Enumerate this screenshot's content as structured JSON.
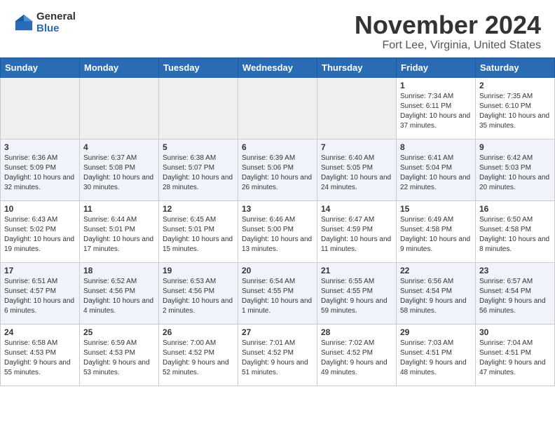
{
  "header": {
    "logo_general": "General",
    "logo_blue": "Blue",
    "month_title": "November 2024",
    "location": "Fort Lee, Virginia, United States"
  },
  "calendar": {
    "days_of_week": [
      "Sunday",
      "Monday",
      "Tuesday",
      "Wednesday",
      "Thursday",
      "Friday",
      "Saturday"
    ],
    "weeks": [
      [
        {
          "day": "",
          "empty": true
        },
        {
          "day": "",
          "empty": true
        },
        {
          "day": "",
          "empty": true
        },
        {
          "day": "",
          "empty": true
        },
        {
          "day": "",
          "empty": true
        },
        {
          "day": "1",
          "sunrise": "Sunrise: 7:34 AM",
          "sunset": "Sunset: 6:11 PM",
          "daylight": "Daylight: 10 hours and 37 minutes."
        },
        {
          "day": "2",
          "sunrise": "Sunrise: 7:35 AM",
          "sunset": "Sunset: 6:10 PM",
          "daylight": "Daylight: 10 hours and 35 minutes."
        }
      ],
      [
        {
          "day": "3",
          "sunrise": "Sunrise: 6:36 AM",
          "sunset": "Sunset: 5:09 PM",
          "daylight": "Daylight: 10 hours and 32 minutes."
        },
        {
          "day": "4",
          "sunrise": "Sunrise: 6:37 AM",
          "sunset": "Sunset: 5:08 PM",
          "daylight": "Daylight: 10 hours and 30 minutes."
        },
        {
          "day": "5",
          "sunrise": "Sunrise: 6:38 AM",
          "sunset": "Sunset: 5:07 PM",
          "daylight": "Daylight: 10 hours and 28 minutes."
        },
        {
          "day": "6",
          "sunrise": "Sunrise: 6:39 AM",
          "sunset": "Sunset: 5:06 PM",
          "daylight": "Daylight: 10 hours and 26 minutes."
        },
        {
          "day": "7",
          "sunrise": "Sunrise: 6:40 AM",
          "sunset": "Sunset: 5:05 PM",
          "daylight": "Daylight: 10 hours and 24 minutes."
        },
        {
          "day": "8",
          "sunrise": "Sunrise: 6:41 AM",
          "sunset": "Sunset: 5:04 PM",
          "daylight": "Daylight: 10 hours and 22 minutes."
        },
        {
          "day": "9",
          "sunrise": "Sunrise: 6:42 AM",
          "sunset": "Sunset: 5:03 PM",
          "daylight": "Daylight: 10 hours and 20 minutes."
        }
      ],
      [
        {
          "day": "10",
          "sunrise": "Sunrise: 6:43 AM",
          "sunset": "Sunset: 5:02 PM",
          "daylight": "Daylight: 10 hours and 19 minutes."
        },
        {
          "day": "11",
          "sunrise": "Sunrise: 6:44 AM",
          "sunset": "Sunset: 5:01 PM",
          "daylight": "Daylight: 10 hours and 17 minutes."
        },
        {
          "day": "12",
          "sunrise": "Sunrise: 6:45 AM",
          "sunset": "Sunset: 5:01 PM",
          "daylight": "Daylight: 10 hours and 15 minutes."
        },
        {
          "day": "13",
          "sunrise": "Sunrise: 6:46 AM",
          "sunset": "Sunset: 5:00 PM",
          "daylight": "Daylight: 10 hours and 13 minutes."
        },
        {
          "day": "14",
          "sunrise": "Sunrise: 6:47 AM",
          "sunset": "Sunset: 4:59 PM",
          "daylight": "Daylight: 10 hours and 11 minutes."
        },
        {
          "day": "15",
          "sunrise": "Sunrise: 6:49 AM",
          "sunset": "Sunset: 4:58 PM",
          "daylight": "Daylight: 10 hours and 9 minutes."
        },
        {
          "day": "16",
          "sunrise": "Sunrise: 6:50 AM",
          "sunset": "Sunset: 4:58 PM",
          "daylight": "Daylight: 10 hours and 8 minutes."
        }
      ],
      [
        {
          "day": "17",
          "sunrise": "Sunrise: 6:51 AM",
          "sunset": "Sunset: 4:57 PM",
          "daylight": "Daylight: 10 hours and 6 minutes."
        },
        {
          "day": "18",
          "sunrise": "Sunrise: 6:52 AM",
          "sunset": "Sunset: 4:56 PM",
          "daylight": "Daylight: 10 hours and 4 minutes."
        },
        {
          "day": "19",
          "sunrise": "Sunrise: 6:53 AM",
          "sunset": "Sunset: 4:56 PM",
          "daylight": "Daylight: 10 hours and 2 minutes."
        },
        {
          "day": "20",
          "sunrise": "Sunrise: 6:54 AM",
          "sunset": "Sunset: 4:55 PM",
          "daylight": "Daylight: 10 hours and 1 minute."
        },
        {
          "day": "21",
          "sunrise": "Sunrise: 6:55 AM",
          "sunset": "Sunset: 4:55 PM",
          "daylight": "Daylight: 9 hours and 59 minutes."
        },
        {
          "day": "22",
          "sunrise": "Sunrise: 6:56 AM",
          "sunset": "Sunset: 4:54 PM",
          "daylight": "Daylight: 9 hours and 58 minutes."
        },
        {
          "day": "23",
          "sunrise": "Sunrise: 6:57 AM",
          "sunset": "Sunset: 4:54 PM",
          "daylight": "Daylight: 9 hours and 56 minutes."
        }
      ],
      [
        {
          "day": "24",
          "sunrise": "Sunrise: 6:58 AM",
          "sunset": "Sunset: 4:53 PM",
          "daylight": "Daylight: 9 hours and 55 minutes."
        },
        {
          "day": "25",
          "sunrise": "Sunrise: 6:59 AM",
          "sunset": "Sunset: 4:53 PM",
          "daylight": "Daylight: 9 hours and 53 minutes."
        },
        {
          "day": "26",
          "sunrise": "Sunrise: 7:00 AM",
          "sunset": "Sunset: 4:52 PM",
          "daylight": "Daylight: 9 hours and 52 minutes."
        },
        {
          "day": "27",
          "sunrise": "Sunrise: 7:01 AM",
          "sunset": "Sunset: 4:52 PM",
          "daylight": "Daylight: 9 hours and 51 minutes."
        },
        {
          "day": "28",
          "sunrise": "Sunrise: 7:02 AM",
          "sunset": "Sunset: 4:52 PM",
          "daylight": "Daylight: 9 hours and 49 minutes."
        },
        {
          "day": "29",
          "sunrise": "Sunrise: 7:03 AM",
          "sunset": "Sunset: 4:51 PM",
          "daylight": "Daylight: 9 hours and 48 minutes."
        },
        {
          "day": "30",
          "sunrise": "Sunrise: 7:04 AM",
          "sunset": "Sunset: 4:51 PM",
          "daylight": "Daylight: 9 hours and 47 minutes."
        }
      ]
    ]
  }
}
